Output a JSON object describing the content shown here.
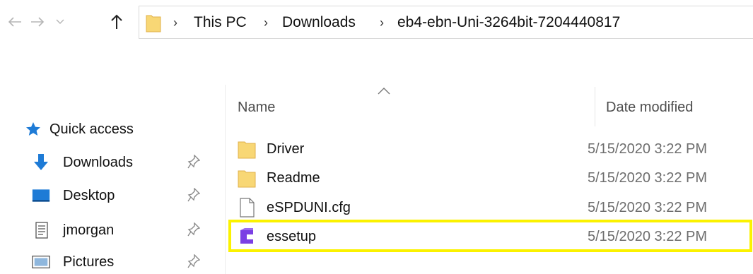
{
  "address_bar": {
    "crumbs": [
      "This PC",
      "Downloads",
      "eb4-ebn-Uni-3264bit-7204440817"
    ]
  },
  "navigation_pane": {
    "items": [
      {
        "label": "Quick access",
        "icon": "star-icon",
        "pinned": false
      },
      {
        "label": "Downloads",
        "icon": "download-arrow-icon",
        "pinned": true
      },
      {
        "label": "Desktop",
        "icon": "desktop-icon",
        "pinned": true
      },
      {
        "label": "jmorgan",
        "icon": "document-icon",
        "pinned": true
      },
      {
        "label": "Pictures",
        "icon": "pictures-icon",
        "pinned": true
      }
    ]
  },
  "file_list": {
    "columns": {
      "name": "Name",
      "date_modified": "Date modified"
    },
    "sorted_by": "Name",
    "rows": [
      {
        "name": "Driver",
        "date": "5/15/2020 3:22 PM",
        "icon": "folder-icon"
      },
      {
        "name": "Readme",
        "date": "5/15/2020 3:22 PM",
        "icon": "folder-icon"
      },
      {
        "name": "eSPDUNI.cfg",
        "date": "5/15/2020 3:22 PM",
        "icon": "file-icon"
      },
      {
        "name": "essetup",
        "date": "5/15/2020 3:22 PM",
        "icon": "installer-icon",
        "highlighted": true
      }
    ]
  },
  "colors": {
    "folder": "#f8d775",
    "accent_blue": "#1e7bd6",
    "installer_purple": "#7b3fe4",
    "highlight": "#fbf200",
    "date_text": "#6d6d6d"
  }
}
